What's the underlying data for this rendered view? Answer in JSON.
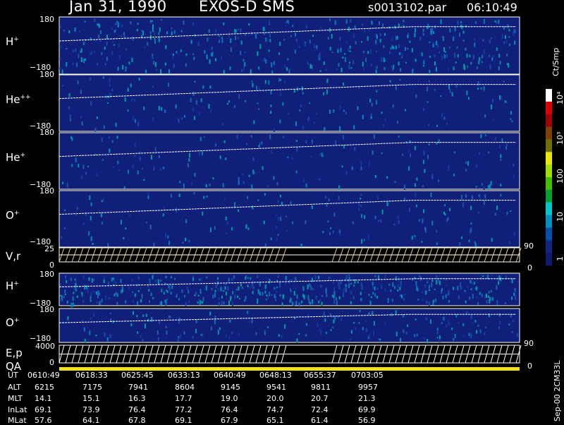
{
  "header": {
    "date": "Jan 31, 1990",
    "instrument": "EXOS-D SMS",
    "file": "s0013102.par",
    "time": "06:10:49"
  },
  "panels": [
    {
      "id": "h-plus",
      "label": "H",
      "sup": "+",
      "ymax": "180",
      "ymin": "−180"
    },
    {
      "id": "he-plusplus",
      "label": "He",
      "sup": "++",
      "ymax": "180",
      "ymin": "−180"
    },
    {
      "id": "he-plus",
      "label": "He",
      "sup": "+",
      "ymax": "180",
      "ymin": "−180"
    },
    {
      "id": "o-plus",
      "label": "O",
      "sup": "+",
      "ymax": "180",
      "ymin": "−180"
    },
    {
      "id": "v-r",
      "label": "V,r",
      "sup": "",
      "ymax": "25",
      "ymin": "0",
      "rmax": "90",
      "rmin": "0"
    },
    {
      "id": "h-plus-2",
      "label": "H",
      "sup": "+",
      "ymax": "180",
      "ymin": "−180"
    },
    {
      "id": "o-plus-2",
      "label": "O",
      "sup": "+",
      "ymax": "180",
      "ymin": "−180"
    },
    {
      "id": "e-p",
      "label": "E,p",
      "sup": "",
      "ymax": "4000",
      "ymin": "0",
      "rmax": "90",
      "rmin": "0"
    }
  ],
  "qa_label": "QA",
  "colorbar": {
    "title": "Ct/Smp",
    "ticks": [
      "10⁴",
      "10³",
      "100",
      "10",
      "1"
    ],
    "colors": [
      "#ffffff",
      "#e00000",
      "#a00000",
      "#804000",
      "#707000",
      "#e8e800",
      "#a0e000",
      "#40c000",
      "#00a030",
      "#00c8c8",
      "#0090c0",
      "#0050b0",
      "#102880",
      "#101870"
    ]
  },
  "footer_note": "Sep-00 2CM33L",
  "table": {
    "row_labels": [
      "UT",
      "ALT",
      "MLT",
      "InLat",
      "MLat"
    ],
    "columns": [
      [
        "0610:49",
        "6215",
        "14.1",
        "69.1",
        "57.6"
      ],
      [
        "0618:33",
        "7175",
        "15.1",
        "73.9",
        "64.1"
      ],
      [
        "0625:45",
        "7941",
        "16.3",
        "76.4",
        "67.8"
      ],
      [
        "0633:13",
        "8604",
        "17.7",
        "77.2",
        "69.1"
      ],
      [
        "0640:49",
        "9145",
        "19.0",
        "76.4",
        "67.9"
      ],
      [
        "0648:13",
        "9541",
        "20.0",
        "74.7",
        "65.1"
      ],
      [
        "0655:37",
        "9811",
        "20.7",
        "72.4",
        "61.4"
      ],
      [
        "0703:05",
        "9957",
        "21.3",
        "69.9",
        "56.9"
      ]
    ]
  },
  "chart_data": {
    "type": "heatmap",
    "title": "Jan 31, 1990   EXOS-D SMS",
    "x_ticks": [
      "0610:49",
      "0618:33",
      "0625:45",
      "0633:13",
      "0640:49",
      "0648:13",
      "0655:37",
      "0703:05"
    ],
    "colorbar_label": "Ct/Smp",
    "colorbar_scale": "log",
    "colorbar_range": [
      1,
      10000
    ],
    "panel_order": [
      "H+",
      "He++",
      "He+",
      "O+",
      "V,r",
      "H+",
      "O+",
      "E,p",
      "QA"
    ]
  }
}
